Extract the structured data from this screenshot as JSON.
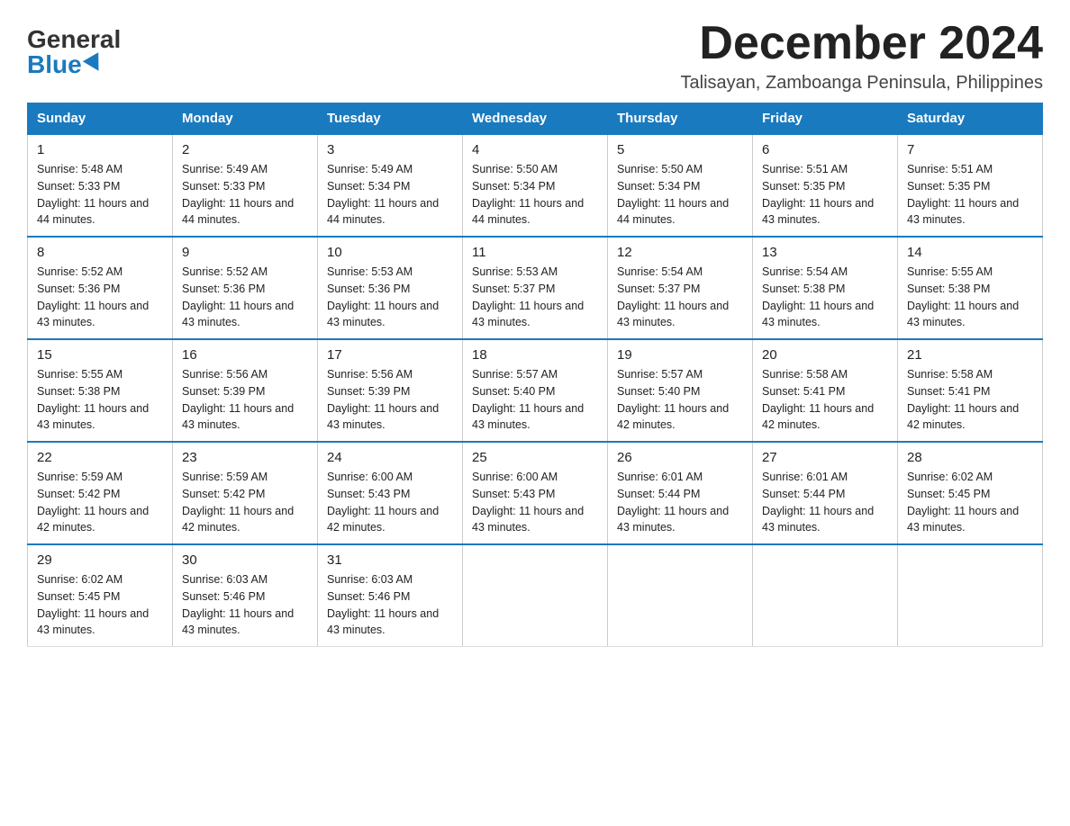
{
  "logo": {
    "general": "General",
    "blue": "Blue"
  },
  "title": {
    "month_year": "December 2024",
    "location": "Talisayan, Zamboanga Peninsula, Philippines"
  },
  "days_of_week": [
    "Sunday",
    "Monday",
    "Tuesday",
    "Wednesday",
    "Thursday",
    "Friday",
    "Saturday"
  ],
  "weeks": [
    [
      {
        "day": "1",
        "sunrise": "Sunrise: 5:48 AM",
        "sunset": "Sunset: 5:33 PM",
        "daylight": "Daylight: 11 hours and 44 minutes."
      },
      {
        "day": "2",
        "sunrise": "Sunrise: 5:49 AM",
        "sunset": "Sunset: 5:33 PM",
        "daylight": "Daylight: 11 hours and 44 minutes."
      },
      {
        "day": "3",
        "sunrise": "Sunrise: 5:49 AM",
        "sunset": "Sunset: 5:34 PM",
        "daylight": "Daylight: 11 hours and 44 minutes."
      },
      {
        "day": "4",
        "sunrise": "Sunrise: 5:50 AM",
        "sunset": "Sunset: 5:34 PM",
        "daylight": "Daylight: 11 hours and 44 minutes."
      },
      {
        "day": "5",
        "sunrise": "Sunrise: 5:50 AM",
        "sunset": "Sunset: 5:34 PM",
        "daylight": "Daylight: 11 hours and 44 minutes."
      },
      {
        "day": "6",
        "sunrise": "Sunrise: 5:51 AM",
        "sunset": "Sunset: 5:35 PM",
        "daylight": "Daylight: 11 hours and 43 minutes."
      },
      {
        "day": "7",
        "sunrise": "Sunrise: 5:51 AM",
        "sunset": "Sunset: 5:35 PM",
        "daylight": "Daylight: 11 hours and 43 minutes."
      }
    ],
    [
      {
        "day": "8",
        "sunrise": "Sunrise: 5:52 AM",
        "sunset": "Sunset: 5:36 PM",
        "daylight": "Daylight: 11 hours and 43 minutes."
      },
      {
        "day": "9",
        "sunrise": "Sunrise: 5:52 AM",
        "sunset": "Sunset: 5:36 PM",
        "daylight": "Daylight: 11 hours and 43 minutes."
      },
      {
        "day": "10",
        "sunrise": "Sunrise: 5:53 AM",
        "sunset": "Sunset: 5:36 PM",
        "daylight": "Daylight: 11 hours and 43 minutes."
      },
      {
        "day": "11",
        "sunrise": "Sunrise: 5:53 AM",
        "sunset": "Sunset: 5:37 PM",
        "daylight": "Daylight: 11 hours and 43 minutes."
      },
      {
        "day": "12",
        "sunrise": "Sunrise: 5:54 AM",
        "sunset": "Sunset: 5:37 PM",
        "daylight": "Daylight: 11 hours and 43 minutes."
      },
      {
        "day": "13",
        "sunrise": "Sunrise: 5:54 AM",
        "sunset": "Sunset: 5:38 PM",
        "daylight": "Daylight: 11 hours and 43 minutes."
      },
      {
        "day": "14",
        "sunrise": "Sunrise: 5:55 AM",
        "sunset": "Sunset: 5:38 PM",
        "daylight": "Daylight: 11 hours and 43 minutes."
      }
    ],
    [
      {
        "day": "15",
        "sunrise": "Sunrise: 5:55 AM",
        "sunset": "Sunset: 5:38 PM",
        "daylight": "Daylight: 11 hours and 43 minutes."
      },
      {
        "day": "16",
        "sunrise": "Sunrise: 5:56 AM",
        "sunset": "Sunset: 5:39 PM",
        "daylight": "Daylight: 11 hours and 43 minutes."
      },
      {
        "day": "17",
        "sunrise": "Sunrise: 5:56 AM",
        "sunset": "Sunset: 5:39 PM",
        "daylight": "Daylight: 11 hours and 43 minutes."
      },
      {
        "day": "18",
        "sunrise": "Sunrise: 5:57 AM",
        "sunset": "Sunset: 5:40 PM",
        "daylight": "Daylight: 11 hours and 43 minutes."
      },
      {
        "day": "19",
        "sunrise": "Sunrise: 5:57 AM",
        "sunset": "Sunset: 5:40 PM",
        "daylight": "Daylight: 11 hours and 42 minutes."
      },
      {
        "day": "20",
        "sunrise": "Sunrise: 5:58 AM",
        "sunset": "Sunset: 5:41 PM",
        "daylight": "Daylight: 11 hours and 42 minutes."
      },
      {
        "day": "21",
        "sunrise": "Sunrise: 5:58 AM",
        "sunset": "Sunset: 5:41 PM",
        "daylight": "Daylight: 11 hours and 42 minutes."
      }
    ],
    [
      {
        "day": "22",
        "sunrise": "Sunrise: 5:59 AM",
        "sunset": "Sunset: 5:42 PM",
        "daylight": "Daylight: 11 hours and 42 minutes."
      },
      {
        "day": "23",
        "sunrise": "Sunrise: 5:59 AM",
        "sunset": "Sunset: 5:42 PM",
        "daylight": "Daylight: 11 hours and 42 minutes."
      },
      {
        "day": "24",
        "sunrise": "Sunrise: 6:00 AM",
        "sunset": "Sunset: 5:43 PM",
        "daylight": "Daylight: 11 hours and 42 minutes."
      },
      {
        "day": "25",
        "sunrise": "Sunrise: 6:00 AM",
        "sunset": "Sunset: 5:43 PM",
        "daylight": "Daylight: 11 hours and 43 minutes."
      },
      {
        "day": "26",
        "sunrise": "Sunrise: 6:01 AM",
        "sunset": "Sunset: 5:44 PM",
        "daylight": "Daylight: 11 hours and 43 minutes."
      },
      {
        "day": "27",
        "sunrise": "Sunrise: 6:01 AM",
        "sunset": "Sunset: 5:44 PM",
        "daylight": "Daylight: 11 hours and 43 minutes."
      },
      {
        "day": "28",
        "sunrise": "Sunrise: 6:02 AM",
        "sunset": "Sunset: 5:45 PM",
        "daylight": "Daylight: 11 hours and 43 minutes."
      }
    ],
    [
      {
        "day": "29",
        "sunrise": "Sunrise: 6:02 AM",
        "sunset": "Sunset: 5:45 PM",
        "daylight": "Daylight: 11 hours and 43 minutes."
      },
      {
        "day": "30",
        "sunrise": "Sunrise: 6:03 AM",
        "sunset": "Sunset: 5:46 PM",
        "daylight": "Daylight: 11 hours and 43 minutes."
      },
      {
        "day": "31",
        "sunrise": "Sunrise: 6:03 AM",
        "sunset": "Sunset: 5:46 PM",
        "daylight": "Daylight: 11 hours and 43 minutes."
      },
      null,
      null,
      null,
      null
    ]
  ]
}
